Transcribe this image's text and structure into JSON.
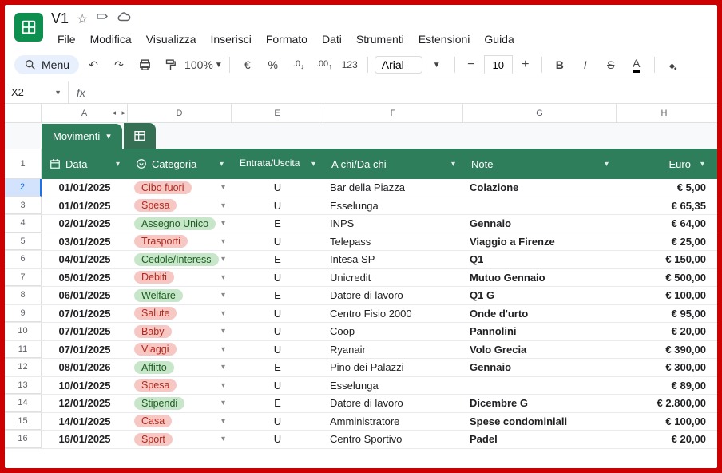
{
  "doc": {
    "title": "V1"
  },
  "menus": [
    "File",
    "Modifica",
    "Visualizza",
    "Inserisci",
    "Formato",
    "Dati",
    "Strumenti",
    "Estensioni",
    "Guida"
  ],
  "toolbar": {
    "menu": "Menu",
    "zoom": "100%",
    "font": "Arial",
    "size": "10",
    "symbols": {
      "euro": "€",
      "pct": "%",
      "dec_dec": ".0",
      "dec_inc": ".00",
      "num": "123"
    }
  },
  "cellref": "X2",
  "cols": [
    "A",
    "D",
    "E",
    "F",
    "G",
    "H"
  ],
  "tab": "Movimenti",
  "headers": {
    "rownum": "1",
    "data": "Data",
    "categoria": "Categoria",
    "eu": "Entrata/Uscita",
    "achi": "A chi/Da chi",
    "note": "Note",
    "euro": "Euro"
  },
  "rows": [
    {
      "n": "2",
      "date": "01/01/2025",
      "cat": "Cibo fuori",
      "ck": "red",
      "eu": "U",
      "who": "Bar della Piazza",
      "note": "Colazione",
      "eur": "€ 5,00",
      "sel": true
    },
    {
      "n": "3",
      "date": "01/01/2025",
      "cat": "Spesa",
      "ck": "red",
      "eu": "U",
      "who": "Esselunga",
      "note": "",
      "eur": "€ 65,35"
    },
    {
      "n": "4",
      "date": "02/01/2025",
      "cat": "Assegno Unico",
      "ck": "green",
      "eu": "E",
      "who": "INPS",
      "note": "Gennaio",
      "eur": "€ 64,00"
    },
    {
      "n": "5",
      "date": "03/01/2025",
      "cat": "Trasporti",
      "ck": "red",
      "eu": "U",
      "who": "Telepass",
      "note": "Viaggio a Firenze",
      "eur": "€ 25,00"
    },
    {
      "n": "6",
      "date": "04/01/2025",
      "cat": "Cedole/Interess",
      "ck": "green",
      "eu": "E",
      "who": "Intesa SP",
      "note": "Q1",
      "eur": "€ 150,00"
    },
    {
      "n": "7",
      "date": "05/01/2025",
      "cat": "Debiti",
      "ck": "red",
      "eu": "U",
      "who": "Unicredit",
      "note": "Mutuo Gennaio",
      "eur": "€ 500,00"
    },
    {
      "n": "8",
      "date": "06/01/2025",
      "cat": "Welfare",
      "ck": "green",
      "eu": "E",
      "who": "Datore di lavoro",
      "note": "Q1 G",
      "eur": "€ 100,00"
    },
    {
      "n": "9",
      "date": "07/01/2025",
      "cat": "Salute",
      "ck": "red",
      "eu": "U",
      "who": "Centro Fisio 2000",
      "note": "Onde d'urto",
      "eur": "€ 95,00"
    },
    {
      "n": "10",
      "date": "07/01/2025",
      "cat": "Baby",
      "ck": "red",
      "eu": "U",
      "who": "Coop",
      "note": "Pannolini",
      "eur": "€ 20,00"
    },
    {
      "n": "11",
      "date": "07/01/2025",
      "cat": "Viaggi",
      "ck": "red",
      "eu": "U",
      "who": "Ryanair",
      "note": "Volo Grecia",
      "eur": "€ 390,00"
    },
    {
      "n": "12",
      "date": "08/01/2026",
      "cat": "Affitto",
      "ck": "green",
      "eu": "E",
      "who": "Pino dei Palazzi",
      "note": "Gennaio",
      "eur": "€ 300,00"
    },
    {
      "n": "13",
      "date": "10/01/2025",
      "cat": "Spesa",
      "ck": "red",
      "eu": "U",
      "who": "Esselunga",
      "note": "",
      "eur": "€ 89,00"
    },
    {
      "n": "14",
      "date": "12/01/2025",
      "cat": "Stipendi",
      "ck": "green",
      "eu": "E",
      "who": "Datore di lavoro",
      "note": "Dicembre G",
      "eur": "€ 2.800,00"
    },
    {
      "n": "15",
      "date": "14/01/2025",
      "cat": "Casa",
      "ck": "red",
      "eu": "U",
      "who": "Amministratore",
      "note": "Spese condominiali",
      "eur": "€ 100,00"
    },
    {
      "n": "16",
      "date": "16/01/2025",
      "cat": "Sport",
      "ck": "red",
      "eu": "U",
      "who": "Centro Sportivo",
      "note": "Padel",
      "eur": "€ 20,00"
    }
  ]
}
